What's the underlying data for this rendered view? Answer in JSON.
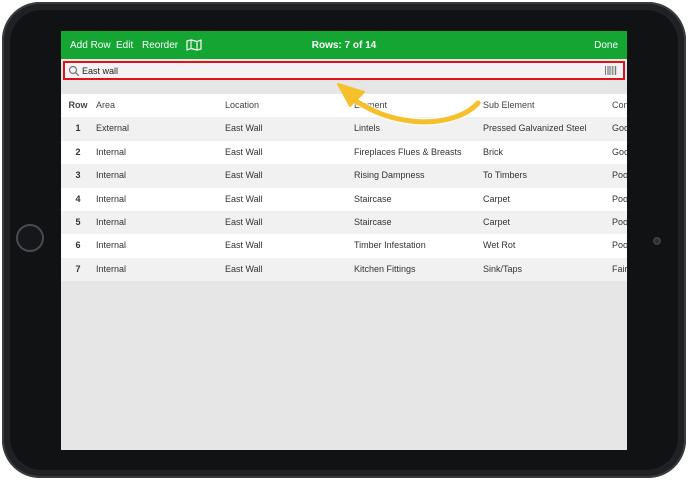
{
  "toolbar": {
    "add_row_label": "Add Row",
    "edit_label": "Edit",
    "reorder_label": "Reorder",
    "title": "Rows: 7 of 14",
    "done_label": "Done"
  },
  "search": {
    "value": "East wall"
  },
  "table": {
    "headers": [
      "Row",
      "Area",
      "Location",
      "Element",
      "Sub Element",
      "Condition"
    ],
    "rows": [
      [
        "1",
        "External",
        "East Wall",
        "Lintels",
        "Pressed Galvanized Steel",
        "Good"
      ],
      [
        "2",
        "Internal",
        "East Wall",
        "Fireplaces Flues & Breasts",
        "Brick",
        "Good"
      ],
      [
        "3",
        "Internal",
        "East Wall",
        "Rising Dampness",
        "To Timbers",
        "Poor"
      ],
      [
        "4",
        "Internal",
        "East Wall",
        "Staircase",
        "Carpet",
        "Poor"
      ],
      [
        "5",
        "Internal",
        "East Wall",
        "Staircase",
        "Carpet",
        "Poor"
      ],
      [
        "6",
        "Internal",
        "East Wall",
        "Timber Infestation",
        "Wet Rot",
        "Poor"
      ],
      [
        "7",
        "Internal",
        "East Wall",
        "Kitchen Fittings",
        "Sink/Taps",
        "Fair"
      ]
    ]
  },
  "colors": {
    "toolbar": "#14a533",
    "highlight": "#e0131c",
    "arrow": "#f5c02a"
  },
  "icons": [
    "map-icon",
    "search-icon",
    "barcode-icon",
    "arrow-annotation"
  ]
}
